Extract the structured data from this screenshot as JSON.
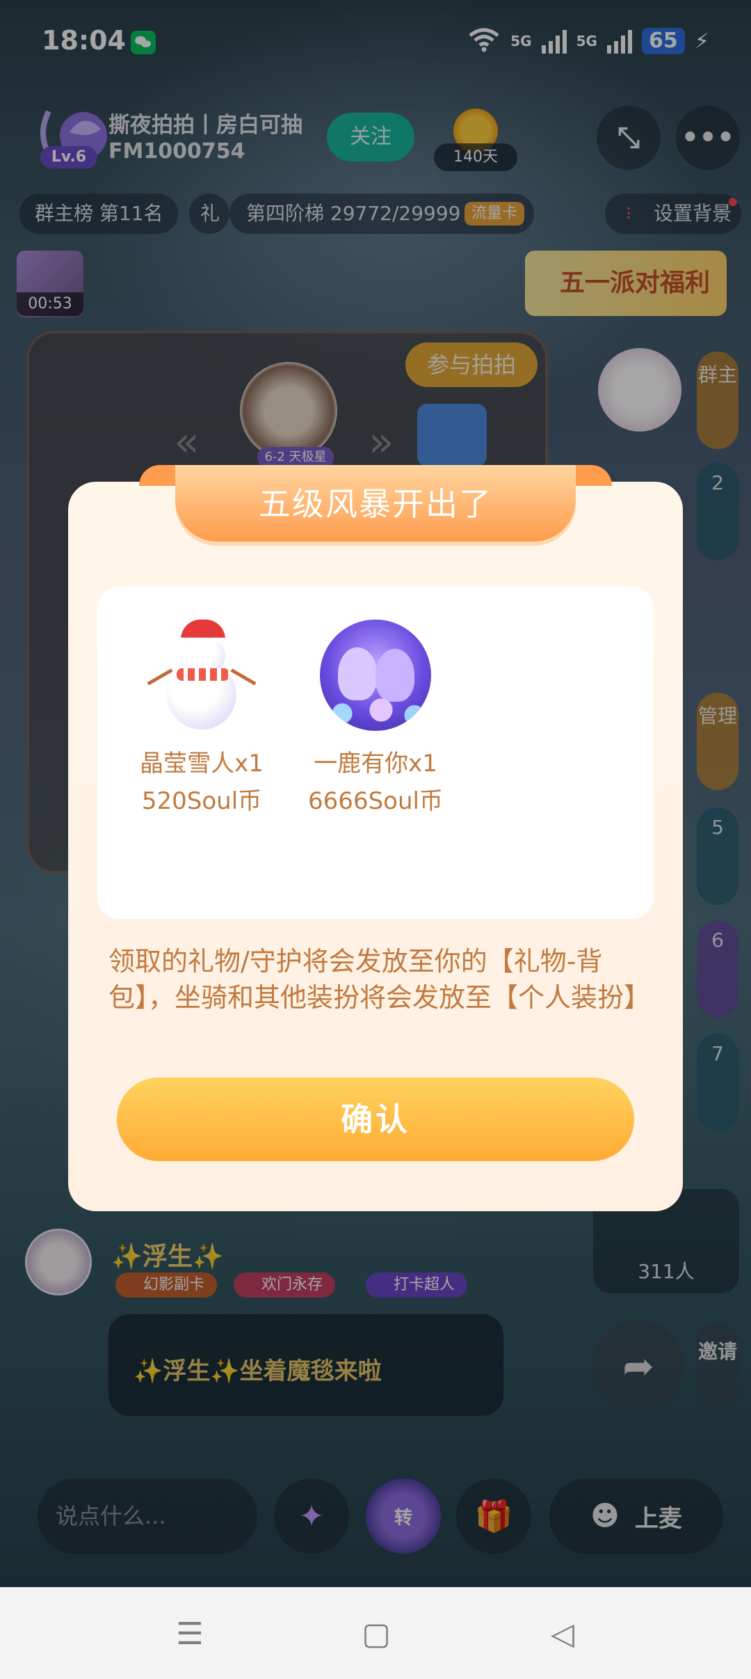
{
  "status_bar": {
    "time": "18:04",
    "network1": "5G",
    "network2": "5G",
    "battery": "65"
  },
  "room": {
    "level": "Lv.6",
    "title": "撕夜拍拍丨房白可抽",
    "id": "FM1000754",
    "follow_label": "关注",
    "days": "140天"
  },
  "chips": {
    "rank": "群主榜 第11名",
    "gift_partial": "礼",
    "ladder": "第四阶梯 29772/29999",
    "flow_tag": "流量卡",
    "set_bg": "设置背景"
  },
  "thumb_time": "00:53",
  "promo_text": "五一派对福利",
  "game": {
    "join_label": "参与拍拍",
    "star_tag": "6-2 天极星"
  },
  "seats": [
    {
      "label": "群主"
    },
    {
      "label": "2"
    },
    {
      "label": "管理"
    },
    {
      "label": "5"
    },
    {
      "label": "6"
    },
    {
      "label": "7"
    }
  ],
  "chat": {
    "member_name": "✨浮生✨",
    "badges": [
      "幻影副卡",
      "欢门永存",
      "打卡超人"
    ],
    "notice": "✨浮生✨坐着魔毯来啦"
  },
  "online_count": "311人",
  "invite_label": "邀请",
  "toolbar": {
    "input_placeholder": "说点什么...",
    "turntable_label": "转",
    "mic_label": "上麦"
  },
  "dialog": {
    "title": "五级风暴开出了",
    "gifts": [
      {
        "name": "晶莹雪人x1",
        "price": "520Soul币",
        "icon": "snowman-icon"
      },
      {
        "name": "一鹿有你x1",
        "price": "6666Soul币",
        "icon": "deer-pair-icon"
      }
    ],
    "description": "领取的礼物/守护将会发放至你的【礼物-背包】，坐骑和其他装扮将会发放至【个人装扮】",
    "confirm_label": "确认"
  },
  "colors": {
    "dialog_text": "#c17a3f",
    "confirm_button": "#ffbe45",
    "ribbon": "#ff9c4d",
    "follow_button": "#18b6a0"
  }
}
